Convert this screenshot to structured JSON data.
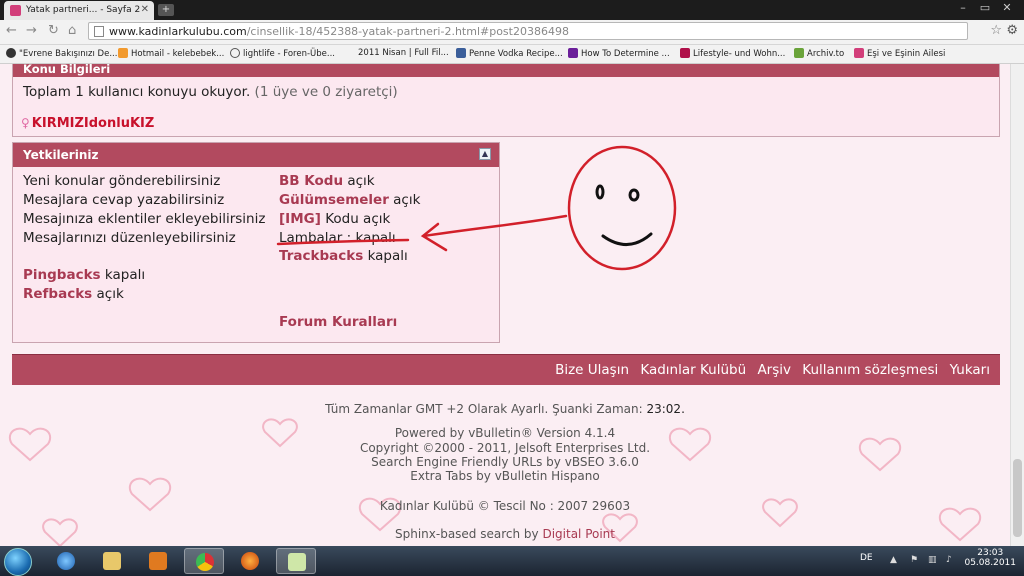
{
  "browser": {
    "tab_title": "Yatak partneri... - Sayfa 2",
    "url_host": "www.kadinlarkulubu.com",
    "url_path": "/cinsellik-18/452388-yatak-partneri-2.html#post20386498",
    "bookmarks": [
      "\"Evrene Bakışınızı De...",
      "Hotmail - kelebebek...",
      "lightlife - Foren-Übe...",
      "2011 Nisan | Full Fil...",
      "Penne Vodka Recipe...",
      "How To Determine ...",
      "Lifestyle- und Wohn...",
      "Archiv.to",
      "Eşi ve Eşinin Ailesi"
    ]
  },
  "konu": {
    "title": "Konu Bilgileri",
    "viewers_text": "Toplam 1 kullanıcı konuyu okuyor.",
    "viewers_detail": "(1 üye ve 0 ziyaretçi)",
    "user": "KIRMIZIdonluKIZ"
  },
  "yetki": {
    "title": "Yetkileriniz",
    "left": [
      "Yeni konular gönderebilirsiniz",
      "Mesajlara cevap yazabilirsiniz",
      "Mesajınıza eklentiler ekleyebilirsiniz",
      "Mesajlarınızı düzenleyebilirsiniz"
    ],
    "pingbacks_label": "Pingbacks",
    "pingbacks_status": "kapalı",
    "refbacks_label": "Refbacks",
    "refbacks_status": "açık",
    "bbcode_label": "BB Kodu",
    "bbcode_status": "açık",
    "smilies_label": "Gülümsemeler",
    "smilies_status": "açık",
    "img_label": "[IMG]",
    "img_status": "Kodu açık",
    "lamps_text": "Lambalar : kapalı",
    "trackbacks_label": "Trackbacks",
    "trackbacks_status": "kapalı",
    "rules_link": "Forum Kuralları"
  },
  "footer": {
    "links": [
      "Bize Ulaşın",
      "Kadınlar Kulübü",
      "Arşiv",
      "Kullanım sözleşmesi",
      "Yukarı"
    ],
    "timezone_text": "Tüm Zamanlar GMT +2 Olarak Ayarlı. Şuanki Zaman:",
    "current_time": "23:02.",
    "powered": "Powered by vBulletin® Version 4.1.4",
    "copyright": "Copyright ©2000 - 2011, Jelsoft Enterprises Ltd.",
    "seo": "Search Engine Friendly URLs by vBSEO 3.6.0",
    "tabs": "Extra Tabs by vBulletin Hispano",
    "tescil": "Kadınlar Kulübü © Tescil No : 2007 29603",
    "sphinx_prefix": "Sphinx-based search by",
    "sphinx_link": "Digital Point"
  },
  "taskbar": {
    "language": "DE",
    "time": "23:03",
    "date": "05.08.2011"
  },
  "colors": {
    "header_bg": "#b24a5f",
    "panel_bg": "#fce8f0",
    "link": "#a83a52",
    "annotation_red": "#d2202a"
  }
}
